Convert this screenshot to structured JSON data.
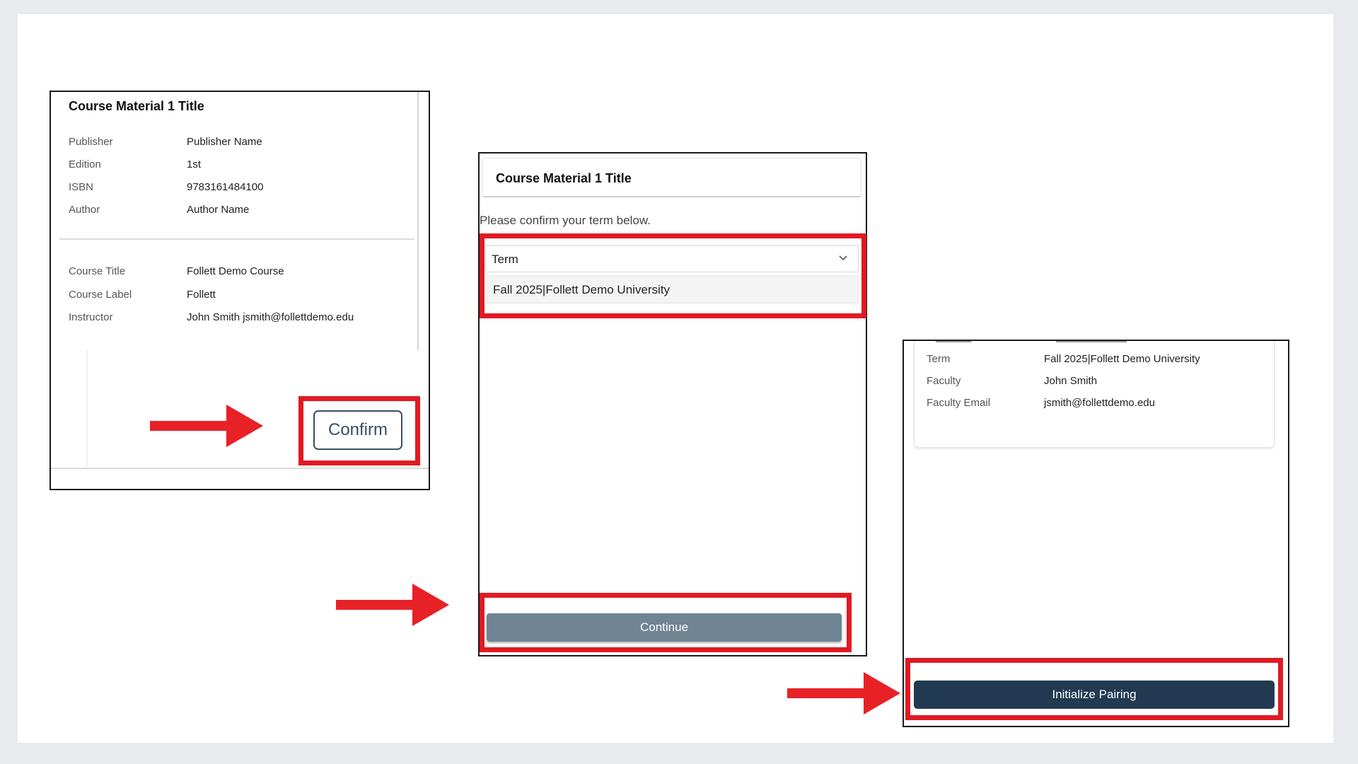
{
  "colors": {
    "highlight": "#e11a22",
    "continue_button": "#6f8594",
    "pair_button": "#213a52",
    "confirm_border": "#3a4f63"
  },
  "panel_material": {
    "title": "Course Material 1 Title",
    "details": [
      {
        "label": "Publisher",
        "value": "Publisher Name"
      },
      {
        "label": "Edition",
        "value": "1st"
      },
      {
        "label": "ISBN",
        "value": "9783161484100"
      },
      {
        "label": "Author",
        "value": "Author Name"
      }
    ],
    "course": [
      {
        "label": "Course Title",
        "value": "Follett Demo Course"
      },
      {
        "label": "Course Label",
        "value": "Follett"
      },
      {
        "label": "Instructor",
        "value": "John Smith jsmith@follettdemo.edu"
      }
    ],
    "confirm_label": "Confirm"
  },
  "panel_term": {
    "title": "Course Material 1 Title",
    "prompt": "Please confirm your term below.",
    "select_label": "Term",
    "select_icon": "chevron-down-icon",
    "option": "Fall 2025|Follett Demo University",
    "continue_label": "Continue"
  },
  "panel_pairing": {
    "rows": [
      {
        "label": "Term",
        "value": "Fall 2025|Follett Demo University"
      },
      {
        "label": "Faculty",
        "value": "John Smith"
      },
      {
        "label": "Faculty Email",
        "value": "jsmith@follettdemo.edu"
      }
    ],
    "pair_label": "Initialize Pairing"
  }
}
